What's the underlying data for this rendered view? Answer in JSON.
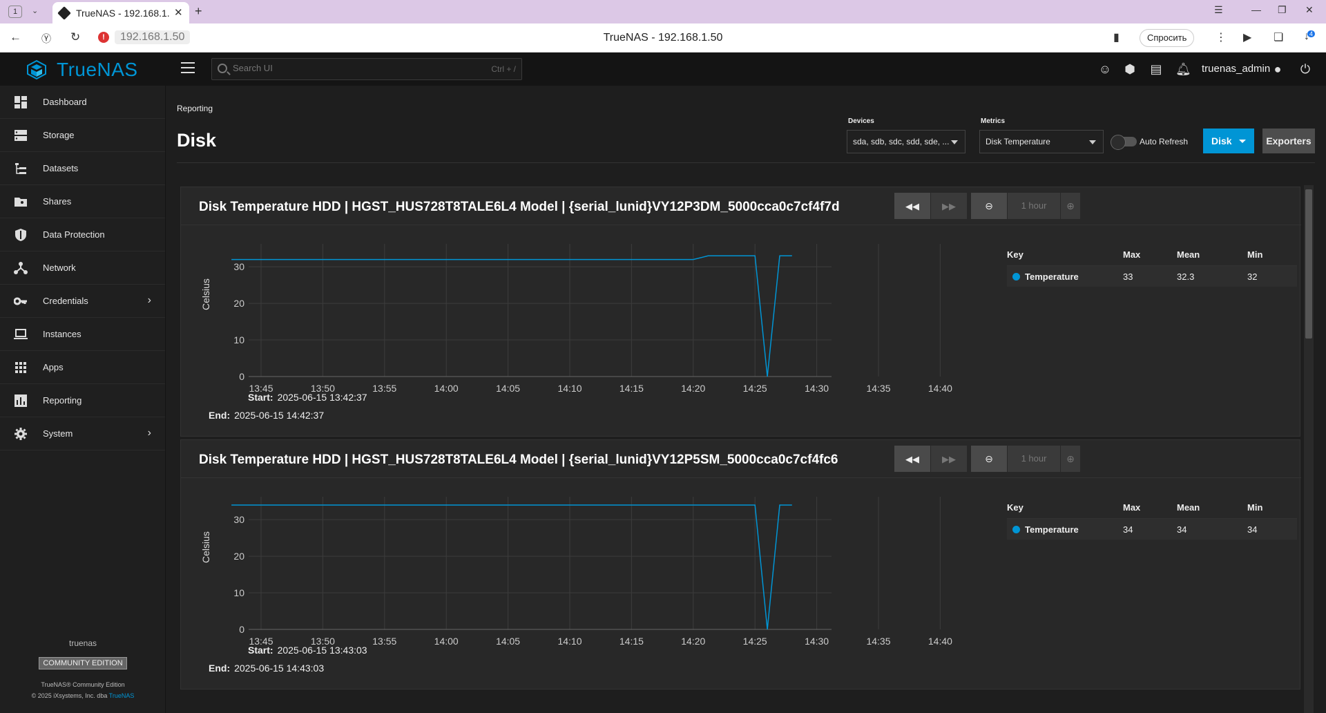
{
  "browser": {
    "tab_count": "1",
    "tab_title": "TrueNAS - 192.168.1.50",
    "url": "192.168.1.50",
    "page_title": "TrueNAS - 192.168.1.50",
    "ask_label": "Спросить",
    "downloads_badge": "4"
  },
  "app": {
    "logo_text": "TrueNAS",
    "search_placeholder": "Search UI",
    "search_shortcut": "Ctrl + /",
    "username": "truenas_admin",
    "accent": "#0095d5"
  },
  "sidebar": {
    "items": [
      {
        "label": "Dashboard",
        "icon": "dashboard-icon"
      },
      {
        "label": "Storage",
        "icon": "storage-icon"
      },
      {
        "label": "Datasets",
        "icon": "datasets-icon"
      },
      {
        "label": "Shares",
        "icon": "shares-icon"
      },
      {
        "label": "Data Protection",
        "icon": "shield-icon"
      },
      {
        "label": "Network",
        "icon": "network-icon"
      },
      {
        "label": "Credentials",
        "icon": "key-icon",
        "expandable": true
      },
      {
        "label": "Instances",
        "icon": "laptop-icon"
      },
      {
        "label": "Apps",
        "icon": "apps-grid-icon"
      },
      {
        "label": "Reporting",
        "icon": "reporting-icon"
      },
      {
        "label": "System",
        "icon": "gear-icon",
        "expandable": true
      }
    ],
    "hostname": "truenas",
    "edition": "COMMUNITY EDITION",
    "copyright1": "TrueNAS® Community Edition",
    "copyright2": "© 2025 iXsystems, Inc. dba",
    "copyright_link": "TrueNAS"
  },
  "page": {
    "breadcrumb": "Reporting",
    "title": "Disk",
    "devices_label": "Devices",
    "devices_value": "sda, sdb, sdc, sdd, sde, ...",
    "metrics_label": "Metrics",
    "metrics_value": "Disk Temperature",
    "auto_refresh_label": "Auto Refresh",
    "auto_refresh_on": false,
    "disk_button": "Disk",
    "exporters_button": "Exporters"
  },
  "cards": [
    {
      "title": "Disk Temperature HDD | HGST_HUS728T8TALE6L4 Model | {serial_lunid}VY12P3DM_5000cca0c7cf4f7d",
      "zoom_label": "1 hour",
      "start_label": "Start:",
      "start": "2025-06-15 13:42:37",
      "end_label": "End:",
      "end": "2025-06-15 14:42:37",
      "legend": {
        "headers": [
          "Key",
          "Max",
          "Mean",
          "Min"
        ],
        "rows": [
          {
            "name": "Temperature",
            "max": "33",
            "mean": "32.3",
            "min": "32"
          }
        ]
      },
      "chart_data": {
        "type": "line",
        "ylabel": "Celsius",
        "ylim": [
          0,
          34
        ],
        "yticks": [
          "0",
          "10",
          "20",
          "30"
        ],
        "xticks": [
          "13:45",
          "13:50",
          "13:55",
          "14:00",
          "14:05",
          "14:10",
          "14:15",
          "14:20",
          "14:25",
          "14:30",
          "14:35",
          "14:40"
        ],
        "x_minutes": [
          -2.4,
          35,
          36.2,
          40,
          41,
          42,
          43
        ],
        "series": [
          {
            "values": [
              32,
              32,
              33,
              33,
              0,
              33,
              33
            ]
          }
        ]
      }
    },
    {
      "title": "Disk Temperature HDD | HGST_HUS728T8TALE6L4 Model | {serial_lunid}VY12P5SM_5000cca0c7cf4fc6",
      "zoom_label": "1 hour",
      "start_label": "Start:",
      "start": "2025-06-15 13:43:03",
      "end_label": "End:",
      "end": "2025-06-15 14:43:03",
      "legend": {
        "headers": [
          "Key",
          "Max",
          "Mean",
          "Min"
        ],
        "rows": [
          {
            "name": "Temperature",
            "max": "34",
            "mean": "34",
            "min": "34"
          }
        ]
      },
      "chart_data": {
        "type": "line",
        "ylabel": "Celsius",
        "ylim": [
          0,
          34
        ],
        "yticks": [
          "0",
          "10",
          "20",
          "30"
        ],
        "xticks": [
          "13:45",
          "13:50",
          "13:55",
          "14:00",
          "14:05",
          "14:10",
          "14:15",
          "14:20",
          "14:25",
          "14:30",
          "14:35",
          "14:40"
        ],
        "x_minutes": [
          -2.4,
          40,
          41,
          42,
          43
        ],
        "series": [
          {
            "values": [
              34,
              34,
              0,
              34,
              34
            ]
          }
        ]
      }
    }
  ]
}
